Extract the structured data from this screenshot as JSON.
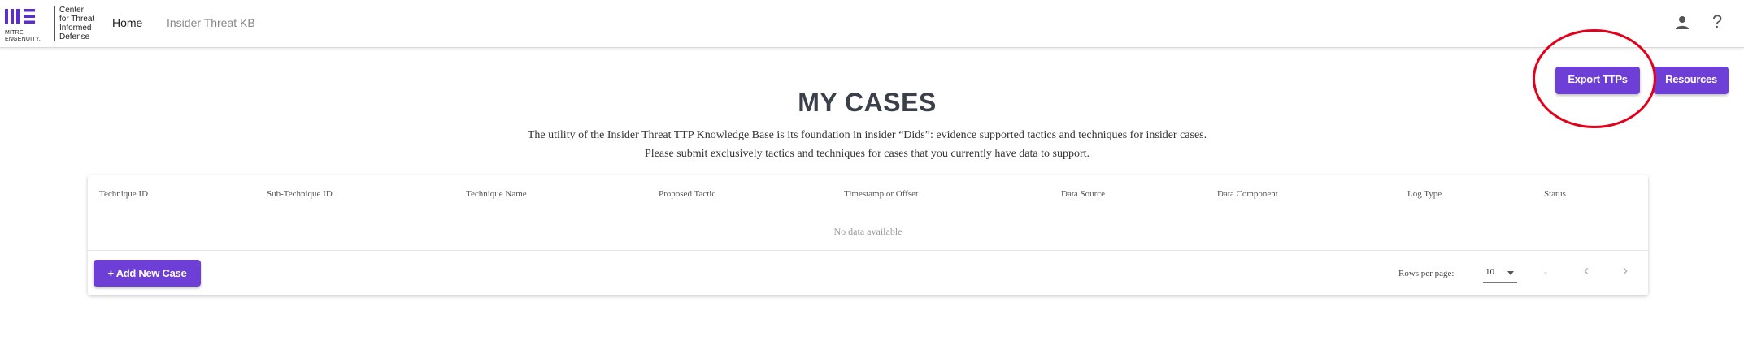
{
  "brand": {
    "logo_word1": "MITRE",
    "logo_word2": "ENGENUITY.",
    "center_line1": "Center",
    "center_line2": "for Threat",
    "center_line3": "Informed",
    "center_line4": "Defense"
  },
  "nav": {
    "home": "Home",
    "kb": "Insider Threat KB"
  },
  "header_icons": {
    "account": "account-icon",
    "help": "?"
  },
  "actions": {
    "export": "Export TTPs",
    "resources": "Resources"
  },
  "page": {
    "title": "MY CASES",
    "subtitle_line1": "The utility of the Insider Threat TTP Knowledge Base is its foundation in insider “Dids”: evidence supported tactics and techniques for insider cases.",
    "subtitle_line2": "Please submit exclusively tactics and techniques for cases that you currently have data to support."
  },
  "table": {
    "headers": [
      "Technique ID",
      "Sub-Technique ID",
      "Technique Name",
      "Proposed Tactic",
      "Timestamp or Offset",
      "Data Source",
      "Data Component",
      "Log Type",
      "Status"
    ],
    "empty_text": "No data available"
  },
  "footer": {
    "add_button": "+ Add New Case",
    "rows_per_page_label": "Rows per page:",
    "rows_per_page_value": "10",
    "range": "-"
  },
  "colors": {
    "accent": "#6e3fd6",
    "highlight_circle": "#e4001b"
  }
}
